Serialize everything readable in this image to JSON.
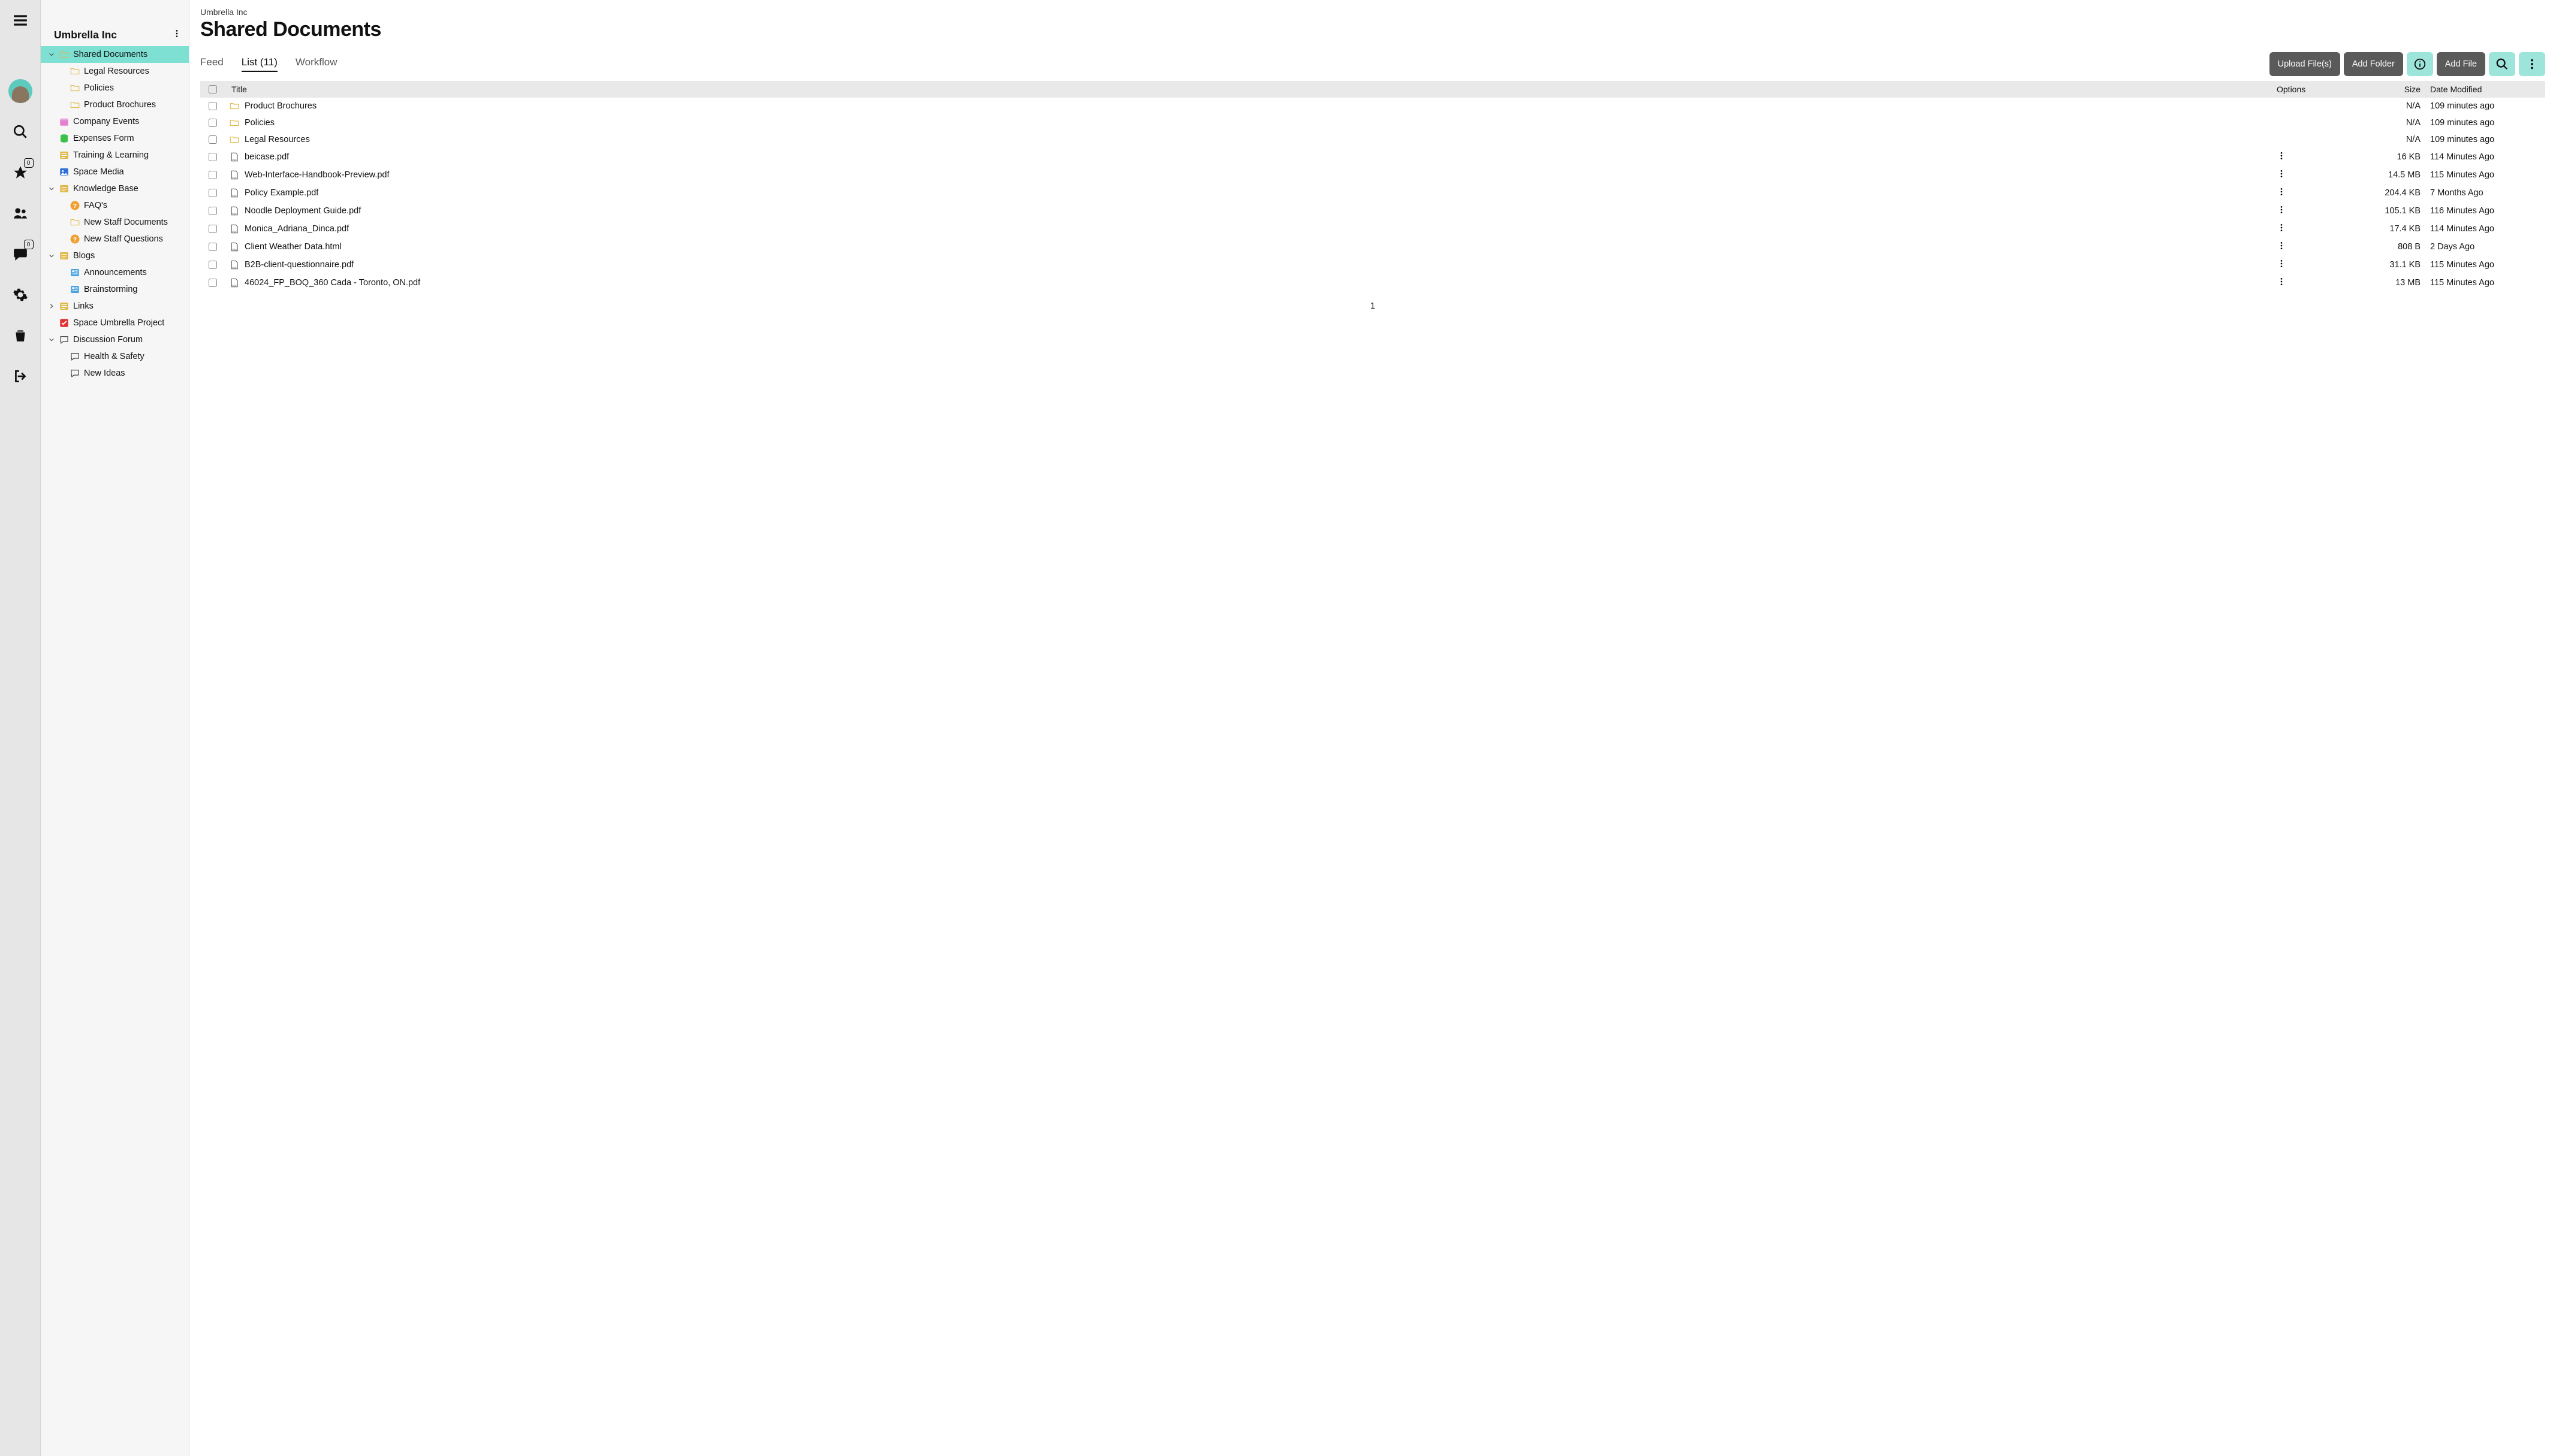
{
  "rail": {
    "favorites_badge": "0",
    "chat_badge": "0"
  },
  "sidebar": {
    "workspace": "Umbrella Inc",
    "items": [
      {
        "label": "Shared Documents",
        "icon": "folder",
        "active": true,
        "expand": "down",
        "indent": 0
      },
      {
        "label": "Legal Resources",
        "icon": "folder",
        "indent": 1
      },
      {
        "label": "Policies",
        "icon": "folder",
        "indent": 1
      },
      {
        "label": "Product Brochures",
        "icon": "folder",
        "indent": 1
      },
      {
        "label": "Company Events",
        "icon": "calendar",
        "indent": 0
      },
      {
        "label": "Expenses Form",
        "icon": "database",
        "indent": 0
      },
      {
        "label": "Training & Learning",
        "icon": "list",
        "indent": 0
      },
      {
        "label": "Space Media",
        "icon": "image",
        "indent": 0
      },
      {
        "label": "Knowledge Base",
        "icon": "list",
        "expand": "down",
        "indent": 0
      },
      {
        "label": "FAQ's",
        "icon": "help",
        "indent": 1
      },
      {
        "label": "New Staff Documents",
        "icon": "folder",
        "indent": 1
      },
      {
        "label": "New Staff Questions",
        "icon": "help",
        "indent": 1
      },
      {
        "label": "Blogs",
        "icon": "list",
        "expand": "down",
        "indent": 0
      },
      {
        "label": "Announcements",
        "icon": "blog",
        "indent": 1
      },
      {
        "label": "Brainstorming",
        "icon": "blog",
        "indent": 1
      },
      {
        "label": "Links",
        "icon": "list",
        "expand": "right",
        "indent": 0
      },
      {
        "label": "Space Umbrella Project",
        "icon": "redcheck",
        "indent": 0
      },
      {
        "label": "Discussion Forum",
        "icon": "chat",
        "expand": "down",
        "indent": 0
      },
      {
        "label": "Health & Safety",
        "icon": "chat",
        "indent": 1
      },
      {
        "label": "New Ideas",
        "icon": "chat",
        "indent": 1
      }
    ]
  },
  "header": {
    "breadcrumb": "Umbrella Inc",
    "title": "Shared Documents"
  },
  "tabs": [
    {
      "label": "Feed",
      "active": false
    },
    {
      "label": "List (11)",
      "active": true
    },
    {
      "label": "Workflow",
      "active": false
    }
  ],
  "actions": {
    "upload": "Upload File(s)",
    "add_folder": "Add Folder",
    "add_file": "Add File"
  },
  "table": {
    "columns": {
      "title": "Title",
      "options": "Options",
      "size": "Size",
      "date": "Date Modified"
    },
    "rows": [
      {
        "type": "folder",
        "title": "Product Brochures",
        "options": false,
        "size": "N/A",
        "date": "109 minutes ago"
      },
      {
        "type": "folder",
        "title": "Policies",
        "options": false,
        "size": "N/A",
        "date": "109 minutes ago"
      },
      {
        "type": "folder",
        "title": "Legal Resources",
        "options": false,
        "size": "N/A",
        "date": "109 minutes ago"
      },
      {
        "type": "pdf",
        "title": "beicase.pdf",
        "options": true,
        "size": "16 KB",
        "date": "114 Minutes Ago"
      },
      {
        "type": "pdf",
        "title": "Web-Interface-Handbook-Preview.pdf",
        "options": true,
        "size": "14.5 MB",
        "date": "115 Minutes Ago"
      },
      {
        "type": "pdf",
        "title": "Policy Example.pdf",
        "options": true,
        "size": "204.4 KB",
        "date": "7 Months Ago"
      },
      {
        "type": "pdf",
        "title": "Noodle Deployment Guide.pdf",
        "options": true,
        "size": "105.1 KB",
        "date": "116 Minutes Ago"
      },
      {
        "type": "pdf",
        "title": "Monica_Adriana_Dinca.pdf",
        "options": true,
        "size": "17.4 KB",
        "date": "114 Minutes Ago"
      },
      {
        "type": "html",
        "title": "Client Weather Data.html",
        "options": true,
        "size": "808 B",
        "date": "2 Days Ago"
      },
      {
        "type": "pdf",
        "title": "B2B-client-questionnaire.pdf",
        "options": true,
        "size": "31.1 KB",
        "date": "115 Minutes Ago"
      },
      {
        "type": "pdf",
        "title": "46024_FP_BOQ_360 Cada - Toronto, ON.pdf",
        "options": true,
        "size": "13 MB",
        "date": "115 Minutes Ago"
      }
    ]
  },
  "pagination": {
    "current": "1"
  }
}
